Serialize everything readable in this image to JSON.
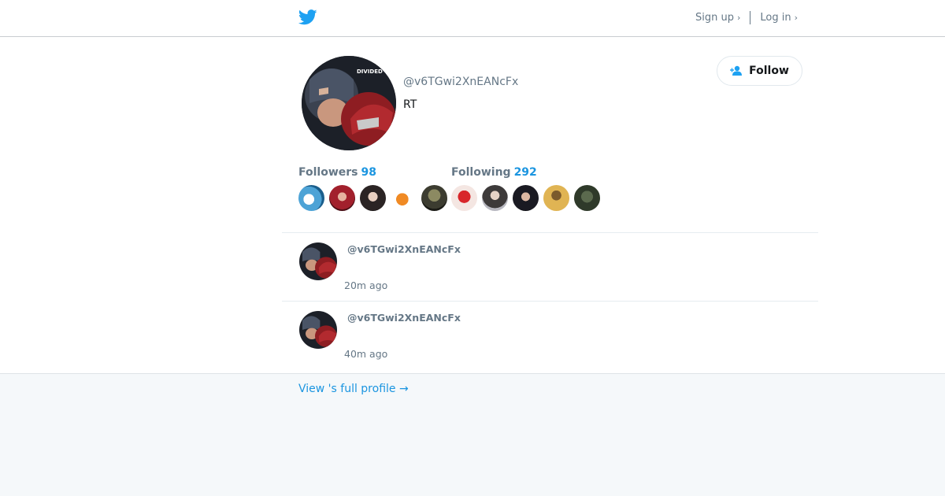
{
  "header": {
    "logo_icon": "twitter-bird-icon",
    "signup_label": "Sign up",
    "login_label": "Log in",
    "chevron": "›"
  },
  "profile": {
    "handle": "@v6TGwi2XnEANcFx",
    "bio": "RT",
    "follow_label": "Follow",
    "followers_label": "Followers",
    "followers_count": "98",
    "following_label": "Following",
    "following_count": "292"
  },
  "tweets": [
    {
      "handle": "@v6TGwi2XnEANcFx",
      "time": "20m ago"
    },
    {
      "handle": "@v6TGwi2XnEANcFx",
      "time": "40m ago"
    }
  ],
  "footer": {
    "full_profile_link": "View 's full profile →"
  },
  "colors": {
    "accent": "#1b95e0",
    "muted": "#657786",
    "page_bg": "#f5f8fa"
  }
}
